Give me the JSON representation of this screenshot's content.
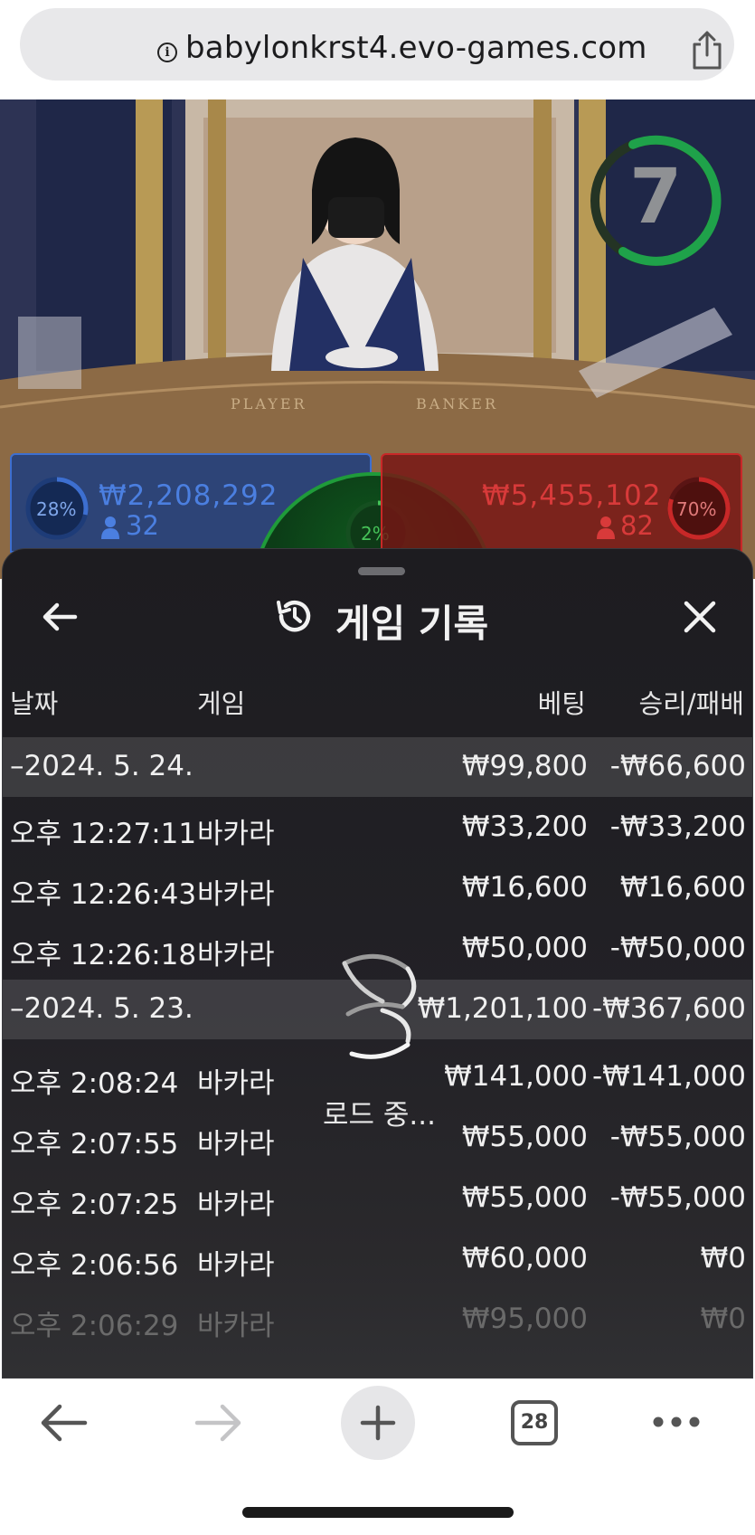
{
  "browser": {
    "url": "babylonkrst4.evo-games.com",
    "tabs_count": "28"
  },
  "video": {
    "timer": "7",
    "table_labels": {
      "player": "PLAYER",
      "banker": "BANKER"
    }
  },
  "bets": {
    "player": {
      "percent": "28%",
      "amount": "₩2,208,292",
      "count": "32",
      "color": "#3d6fd0"
    },
    "tie": {
      "percent": "2%",
      "color": "#1f9b3a"
    },
    "banker": {
      "percent": "70%",
      "amount": "₩5,455,102",
      "count": "82",
      "color": "#c82828"
    }
  },
  "history": {
    "title": "게임 기록",
    "columns": {
      "date": "날짜",
      "game": "게임",
      "bet": "베팅",
      "winloss": "승리/패배"
    },
    "rows": [
      {
        "type": "date",
        "date": "–2024. 5. 24.",
        "game": "",
        "bet": "₩99,800",
        "winloss": "-₩66,600"
      },
      {
        "type": "item",
        "date": "오후 12:27:11",
        "game": "바카라",
        "bet": "₩33,200",
        "winloss": "-₩33,200"
      },
      {
        "type": "item",
        "date": "오후 12:26:43",
        "game": "바카라",
        "bet": "₩16,600",
        "winloss": "₩16,600"
      },
      {
        "type": "item",
        "date": "오후 12:26:18",
        "game": "바카라",
        "bet": "₩50,000",
        "winloss": "-₩50,000"
      },
      {
        "type": "date",
        "date": "–2024. 5. 23.",
        "game": "",
        "bet": "₩1,201,100",
        "winloss": "-₩367,600"
      },
      {
        "type": "item",
        "date": "오후 2:08:24",
        "game": "바카라",
        "bet": "₩141,000",
        "winloss": "-₩141,000"
      },
      {
        "type": "item",
        "date": "오후 2:07:55",
        "game": "바카라",
        "bet": "₩55,000",
        "winloss": "-₩55,000"
      },
      {
        "type": "item",
        "date": "오후 2:07:25",
        "game": "바카라",
        "bet": "₩55,000",
        "winloss": "-₩55,000"
      },
      {
        "type": "item",
        "date": "오후 2:06:56",
        "game": "바카라",
        "bet": "₩60,000",
        "winloss": "₩0"
      },
      {
        "type": "item",
        "date": "오후 2:06:29",
        "game": "바카라",
        "bet": "₩95,000",
        "winloss": "₩0"
      }
    ],
    "loading_text": "로드 중..."
  },
  "icons": {
    "info": "info-icon",
    "share": "share-icon",
    "back": "arrow-left-icon",
    "close": "close-icon",
    "history": "history-icon",
    "loader": "loading-spinner-icon",
    "nav_back": "arrow-left-icon",
    "nav_forward": "arrow-right-icon",
    "new_tab": "plus-icon",
    "more": "more-dots-icon"
  }
}
